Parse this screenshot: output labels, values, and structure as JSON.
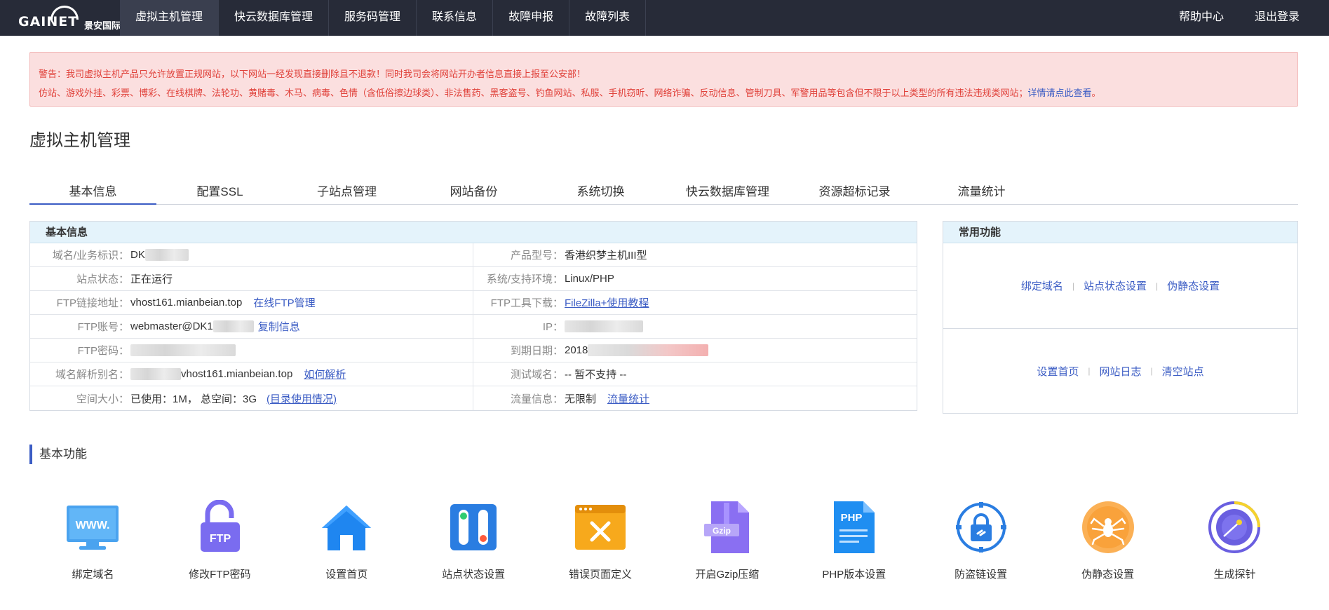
{
  "brand": {
    "logo_text": "GAINET",
    "logo_cn": "景安国际"
  },
  "nav": {
    "items": [
      {
        "label": "虚拟主机管理",
        "active": true
      },
      {
        "label": "快云数据库管理"
      },
      {
        "label": "服务码管理"
      },
      {
        "label": "联系信息"
      },
      {
        "label": "故障申报"
      },
      {
        "label": "故障列表"
      }
    ],
    "right": [
      {
        "label": "帮助中心"
      },
      {
        "label": "退出登录"
      }
    ]
  },
  "warning": {
    "line1": "警告：我司虚拟主机产品只允许放置正规网站，以下网站一经发现直接删除且不退款！同时我司会将网站开办者信息直接上报至公安部！",
    "line2": "仿站、游戏外挂、彩票、博彩、在线棋牌、法轮功、黄赌毒、木马、病毒、色情（含低俗擦边球类）、非法售药、黑客盗号、钓鱼网站、私服、手机窃听、网络诈骗、反动信息、管制刀具、军警用品等包含但不限于以上类型的所有违法违规类网站；",
    "link": "详情请点此查看",
    "tail": "。"
  },
  "page_title": "虚拟主机管理",
  "tabs": [
    {
      "label": "基本信息",
      "active": true
    },
    {
      "label": "配置SSL"
    },
    {
      "label": "子站点管理"
    },
    {
      "label": "网站备份"
    },
    {
      "label": "系统切换"
    },
    {
      "label": "快云数据库管理"
    },
    {
      "label": "资源超标记录"
    },
    {
      "label": "流量统计"
    }
  ],
  "info": {
    "title": "基本信息",
    "rows": [
      {
        "l_label": "域名/业务标识：",
        "l_value": "DK",
        "r_label": "产品型号：",
        "r_value": "香港织梦主机III型"
      },
      {
        "l_label": "站点状态：",
        "l_value": "正在运行",
        "r_label": "系统/支持环境：",
        "r_value": "Linux/PHP"
      },
      {
        "l_label": "FTP链接地址：",
        "l_value": "vhost161.mianbeian.top",
        "l_link": "在线FTP管理",
        "r_label": "FTP工具下载：",
        "r_link": "FileZilla+使用教程"
      },
      {
        "l_label": "FTP账号：",
        "l_value": "webmaster@DK1",
        "l_link": "复制信息",
        "r_label": "IP："
      },
      {
        "l_label": "FTP密码：",
        "r_label": "到期日期：",
        "r_value": "2018"
      },
      {
        "l_label": "域名解析别名：",
        "l_value": "vhost161.mianbeian.top",
        "l_link": "如何解析",
        "r_label": "测试域名：",
        "r_value": "-- 暂不支持 --"
      },
      {
        "l_label": "空间大小：",
        "l_value": "已使用：1M， 总空间：3G",
        "l_link": "(目录使用情况)",
        "r_label": "流量信息：",
        "r_value": "无限制",
        "r_link": "流量统计"
      }
    ]
  },
  "common": {
    "title": "常用功能",
    "row1": [
      "绑定域名",
      "站点状态设置",
      "伪静态设置"
    ],
    "row2": [
      "设置首页",
      "网站日志",
      "清空站点"
    ]
  },
  "basic_functions": {
    "title": "基本功能",
    "items": [
      {
        "label": "绑定域名",
        "icon": "www-monitor-icon"
      },
      {
        "label": "修改FTP密码",
        "icon": "ftp-lock-icon"
      },
      {
        "label": "设置首页",
        "icon": "home-icon"
      },
      {
        "label": "站点状态设置",
        "icon": "toggle-switch-icon"
      },
      {
        "label": "错误页面定义",
        "icon": "error-window-icon"
      },
      {
        "label": "开启Gzip压缩",
        "icon": "gzip-file-icon"
      },
      {
        "label": "PHP版本设置",
        "icon": "php-file-icon"
      },
      {
        "label": "防盗链设置",
        "icon": "link-lock-icon"
      },
      {
        "label": "伪静态设置",
        "icon": "spider-icon"
      },
      {
        "label": "生成探针",
        "icon": "radar-probe-icon"
      }
    ],
    "icon_texts": {
      "www": "WWW.",
      "ftp": "FTP",
      "gzip": "Gzip",
      "php": "PHP"
    }
  },
  "colors": {
    "nav_bg": "#272b38",
    "accent": "#3b5cc4",
    "warning_text": "#e0413a",
    "warning_bg": "#fbdfdf",
    "panel_head": "#e4f3fb"
  }
}
